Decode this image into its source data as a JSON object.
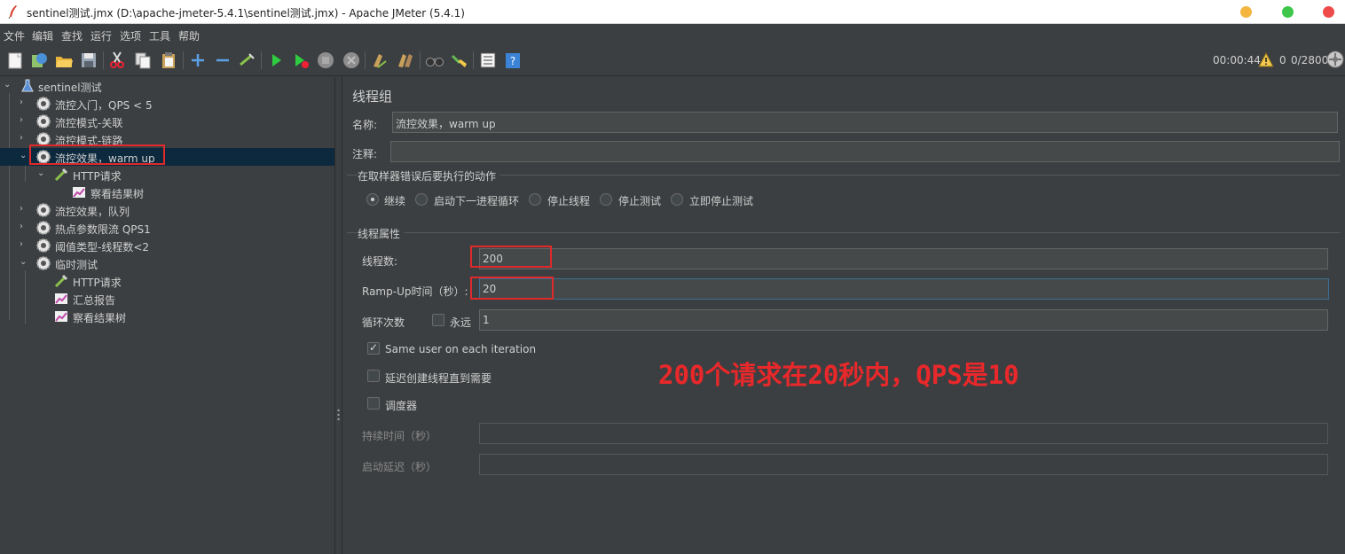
{
  "window": {
    "title": "sentinel测试.jmx (D:\\apache-jmeter-5.4.1\\sentinel测试.jmx) - Apache JMeter (5.4.1)",
    "buttons": {
      "minimize_color": "#f4b63f",
      "maximize_color": "#3dc64a",
      "close_color": "#f04b4b"
    }
  },
  "menu": [
    "文件",
    "编辑",
    "查找",
    "运行",
    "选项",
    "工具",
    "帮助"
  ],
  "toolbar": {
    "icons": [
      "new-icon",
      "templates-icon",
      "open-icon",
      "save-icon",
      "cut-icon",
      "copy-icon",
      "paste-icon",
      "expand-icon",
      "collapse-icon",
      "toggle-icon",
      "start-icon",
      "start-no-pause-icon",
      "stop-icon",
      "shutdown-icon",
      "clear-icon",
      "clear-all-icon",
      "search-icon",
      "reset-search-icon",
      "function-helper-icon",
      "help-icon"
    ],
    "elapsed": "00:00:44",
    "warnings": "0",
    "threads": "0/2800"
  },
  "tree": {
    "root": "sentinel测试",
    "items": [
      {
        "label": "流控入门，QPS < 5"
      },
      {
        "label": "流控模式-关联"
      },
      {
        "label": "流控模式-链路"
      },
      {
        "label": "流控效果，warm up"
      },
      {
        "label": "HTTP请求"
      },
      {
        "label": "察看结果树"
      },
      {
        "label": "流控效果，队列"
      },
      {
        "label": "热点参数限流 QPS1"
      },
      {
        "label": "阈值类型-线程数<2"
      },
      {
        "label": "临时测试"
      },
      {
        "label": "HTTP请求"
      },
      {
        "label": "汇总报告"
      },
      {
        "label": "察看结果树"
      }
    ]
  },
  "panel": {
    "title": "线程组",
    "name_label": "名称:",
    "name_value": "流控效果，warm up",
    "comment_label": "注释:",
    "comment_value": "",
    "error_section": "在取样器错误后要执行的动作",
    "error_options": [
      "继续",
      "启动下一进程循环",
      "停止线程",
      "停止测试",
      "立即停止测试"
    ],
    "error_selected": "继续",
    "props_section": "线程属性",
    "threads_label": "线程数:",
    "threads_value": "200",
    "rampup_label": "Ramp-Up时间（秒）:",
    "rampup_value": "20",
    "loop_label": "循环次数",
    "forever_label": "永远",
    "forever_checked": false,
    "loop_value": "1",
    "same_user_label": "Same user on each iteration",
    "same_user_checked": true,
    "delay_label": "延迟创建线程直到需要",
    "delay_checked": false,
    "scheduler_label": "调度器",
    "scheduler_checked": false,
    "duration_label": "持续时间（秒）",
    "duration_value": "",
    "startup_delay_label": "启动延迟（秒）",
    "startup_delay_value": ""
  },
  "annotation": {
    "text": "200个请求在20秒内，QPS是10",
    "color": "#e8282a"
  }
}
